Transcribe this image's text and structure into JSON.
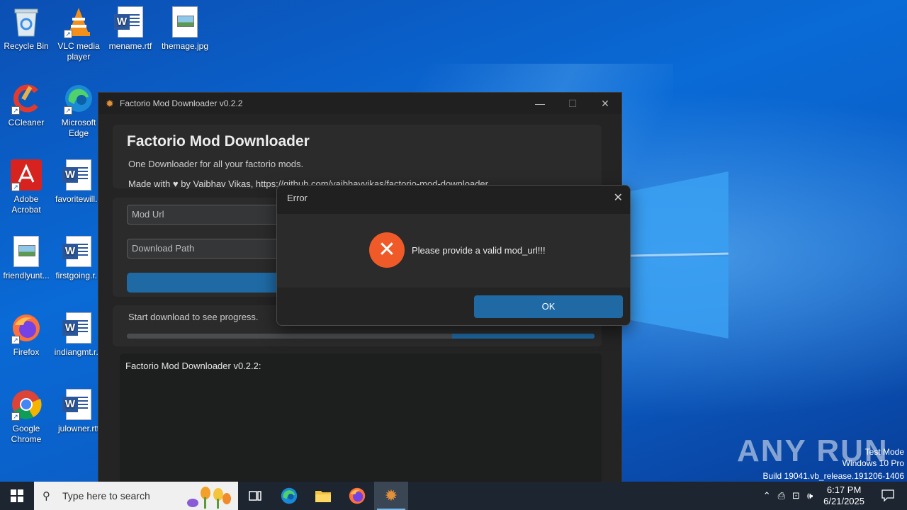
{
  "desktop": {
    "icons": [
      {
        "label": "Recycle Bin",
        "icon": "recycle-bin-icon"
      },
      {
        "label": "VLC media player",
        "icon": "vlc-icon"
      },
      {
        "label": "mename.rtf",
        "icon": "word-document-icon"
      },
      {
        "label": "themage.jpg",
        "icon": "image-file-icon"
      },
      {
        "label": "CCleaner",
        "icon": "ccleaner-icon"
      },
      {
        "label": "Microsoft Edge",
        "icon": "edge-icon"
      },
      {
        "label": "Adobe Acrobat",
        "icon": "acrobat-icon"
      },
      {
        "label": "favoritewill...",
        "icon": "word-document-icon"
      },
      {
        "label": "friendlyunt...",
        "icon": "image-file-icon"
      },
      {
        "label": "firstgoing.r...",
        "icon": "word-document-icon"
      },
      {
        "label": "Firefox",
        "icon": "firefox-icon"
      },
      {
        "label": "indiangmt.r...",
        "icon": "word-document-icon"
      },
      {
        "label": "Google Chrome",
        "icon": "chrome-icon"
      },
      {
        "label": "julowner.rtf",
        "icon": "word-document-icon"
      }
    ]
  },
  "app": {
    "window_title": "Factorio Mod Downloader v0.2.2",
    "controls": {
      "minimize": "—",
      "maximize": "☐",
      "close": "✕"
    },
    "header": {
      "title": "Factorio Mod Downloader",
      "subtitle": "One Downloader for all your factorio mods.",
      "credit": "Made with ♥ by Vaibhav Vikas, https://github.com/vaibhavvikas/factorio-mod-downloader"
    },
    "form": {
      "mod_url_placeholder": "Mod Url",
      "download_path_placeholder": "Download Path"
    },
    "progress": {
      "status": "Start download to see progress.",
      "fill_start": 0.695,
      "fill_end": 1.0
    },
    "log": {
      "text": "Factorio Mod Downloader v0.2.2:"
    }
  },
  "dialog": {
    "title": "Error",
    "close": "✕",
    "message": "Please provide a valid mod_url!!!",
    "ok_label": "OK"
  },
  "watermark": {
    "logo": "ANY RUN",
    "mode": "Test Mode",
    "edition": "Windows 10 Pro",
    "build": "Build 19041.vb_release.191206-1406"
  },
  "taskbar": {
    "search_placeholder": "Type here to search",
    "time": "6:17 PM",
    "date": "6/21/2025"
  },
  "colors": {
    "accent": "#1f6aa5",
    "error": "#f05a28"
  }
}
